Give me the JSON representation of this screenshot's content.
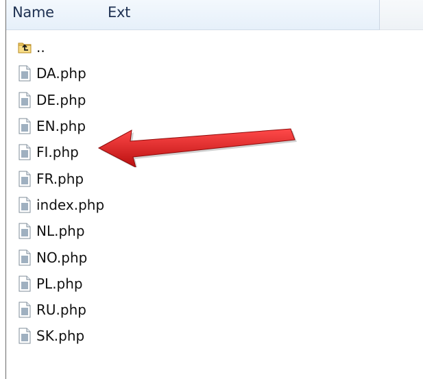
{
  "header": {
    "name_label": "Name",
    "ext_label": "Ext"
  },
  "files": [
    {
      "name": "..",
      "icon": "folder-up-icon"
    },
    {
      "name": "DA.php",
      "icon": "file-icon"
    },
    {
      "name": "DE.php",
      "icon": "file-icon"
    },
    {
      "name": "EN.php",
      "icon": "file-icon"
    },
    {
      "name": "FI.php",
      "icon": "file-icon"
    },
    {
      "name": "FR.php",
      "icon": "file-icon"
    },
    {
      "name": "index.php",
      "icon": "file-icon"
    },
    {
      "name": "NL.php",
      "icon": "file-icon"
    },
    {
      "name": "NO.php",
      "icon": "file-icon"
    },
    {
      "name": "PL.php",
      "icon": "file-icon"
    },
    {
      "name": "RU.php",
      "icon": "file-icon"
    },
    {
      "name": "SK.php",
      "icon": "file-icon"
    }
  ],
  "annotation": {
    "arrow_color": "#e01b1b",
    "points_to": "FI.php"
  }
}
